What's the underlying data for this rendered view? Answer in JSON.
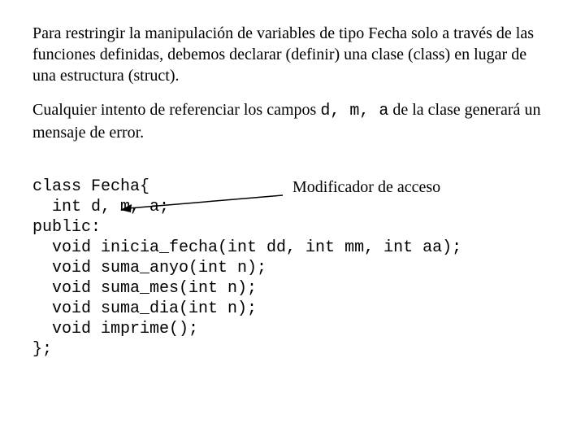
{
  "para1": {
    "text_a": "Para restringir la manipulación de variables de tipo Fecha solo a través de las funciones definidas, debemos declarar (definir) una clase (class) en lugar de una estructura (struct)."
  },
  "para2": {
    "lead": "Cualquier intento de referenciar los campos ",
    "fields": "d, m, a",
    "tail": " de la clase generará un mensaje de error."
  },
  "code": {
    "l1": "class Fecha{",
    "l2": "  int d, m, a;",
    "l3": "public:",
    "l4": "  void inicia_fecha(int dd, int mm, int aa);",
    "l5": "  void suma_anyo(int n);",
    "l6": "  void suma_mes(int n);",
    "l7": "  void suma_dia(int n);",
    "l8": "  void imprime();",
    "l9": "};"
  },
  "annotation": {
    "label": "Modificador de acceso"
  }
}
